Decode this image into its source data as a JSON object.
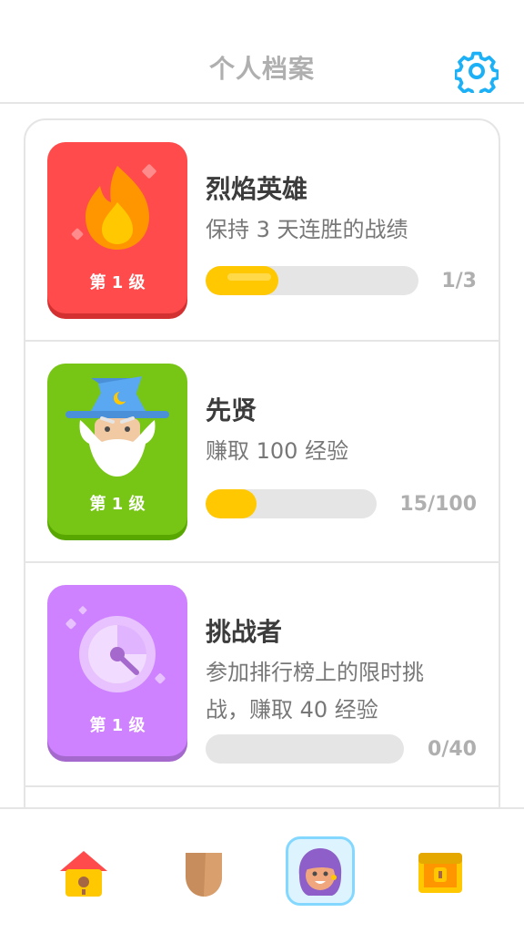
{
  "header": {
    "title": "个人档案",
    "settings_icon": "gear-icon"
  },
  "achievements": [
    {
      "title": "烈焰英雄",
      "description": "保持 3 天连胜的战绩",
      "level": "第 1 级",
      "progress": "1/3",
      "progress_fraction": 0.3333,
      "badge_color": "#ff4b4b",
      "icon": "flame-icon"
    },
    {
      "title": "先贤",
      "description": "赚取 100 经验",
      "level": "第 1 级",
      "progress": "15/100",
      "progress_fraction": 0.3,
      "badge_color": "#77c515",
      "icon": "wizard-icon"
    },
    {
      "title": "挑战者",
      "description_line1": "参加排行榜上的限时挑",
      "description_line2": "战，赚取 40 经验",
      "level": "第 1 级",
      "progress": "0/40",
      "progress_fraction": 0,
      "badge_color": "#ce82ff",
      "icon": "clock-icon"
    }
  ],
  "bottom_nav": [
    {
      "name": "home",
      "icon": "birdhouse-icon",
      "active": false
    },
    {
      "name": "league",
      "icon": "shield-icon",
      "active": false
    },
    {
      "name": "profile",
      "icon": "avatar-icon",
      "active": true
    },
    {
      "name": "shop",
      "icon": "treasure-chest-icon",
      "active": false
    }
  ],
  "colors": {
    "accent": "#1cb0f6",
    "progress": "#ffc800",
    "track": "#e5e5e5",
    "muted": "#afafaf"
  }
}
